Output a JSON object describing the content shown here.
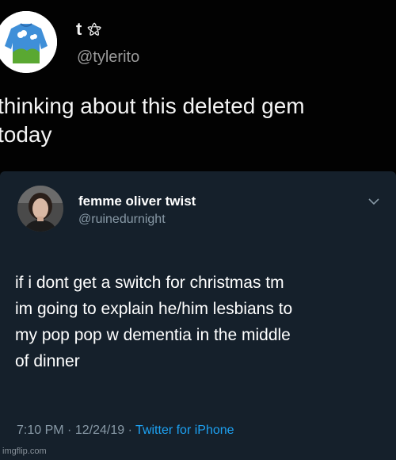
{
  "outer_tweet": {
    "avatar_icon": "sweater-avatar-icon",
    "display_name": "t",
    "name_glyph": "⚝",
    "handle": "@tylerito",
    "text": "thinking about this deleted gem\ntoday"
  },
  "quoted_tweet": {
    "avatar_icon": "profile-photo-avatar",
    "display_name": "femme oliver twist",
    "handle": "@ruinedurnight",
    "menu_icon": "chevron-down-icon",
    "text": "if i dont get a switch for christmas tm\nim going to explain he/him lesbians to\nmy pop pop w dementia in the middle\nof dinner",
    "time": "7:10 PM",
    "separator_1": "·",
    "date": "12/24/19",
    "separator_2": "·",
    "source": "Twitter for iPhone"
  },
  "watermark": "imgflip.com",
  "colors": {
    "background": "#020202",
    "card_background": "#15202b",
    "muted_text": "#8899a6",
    "link_blue": "#1da1f2"
  }
}
